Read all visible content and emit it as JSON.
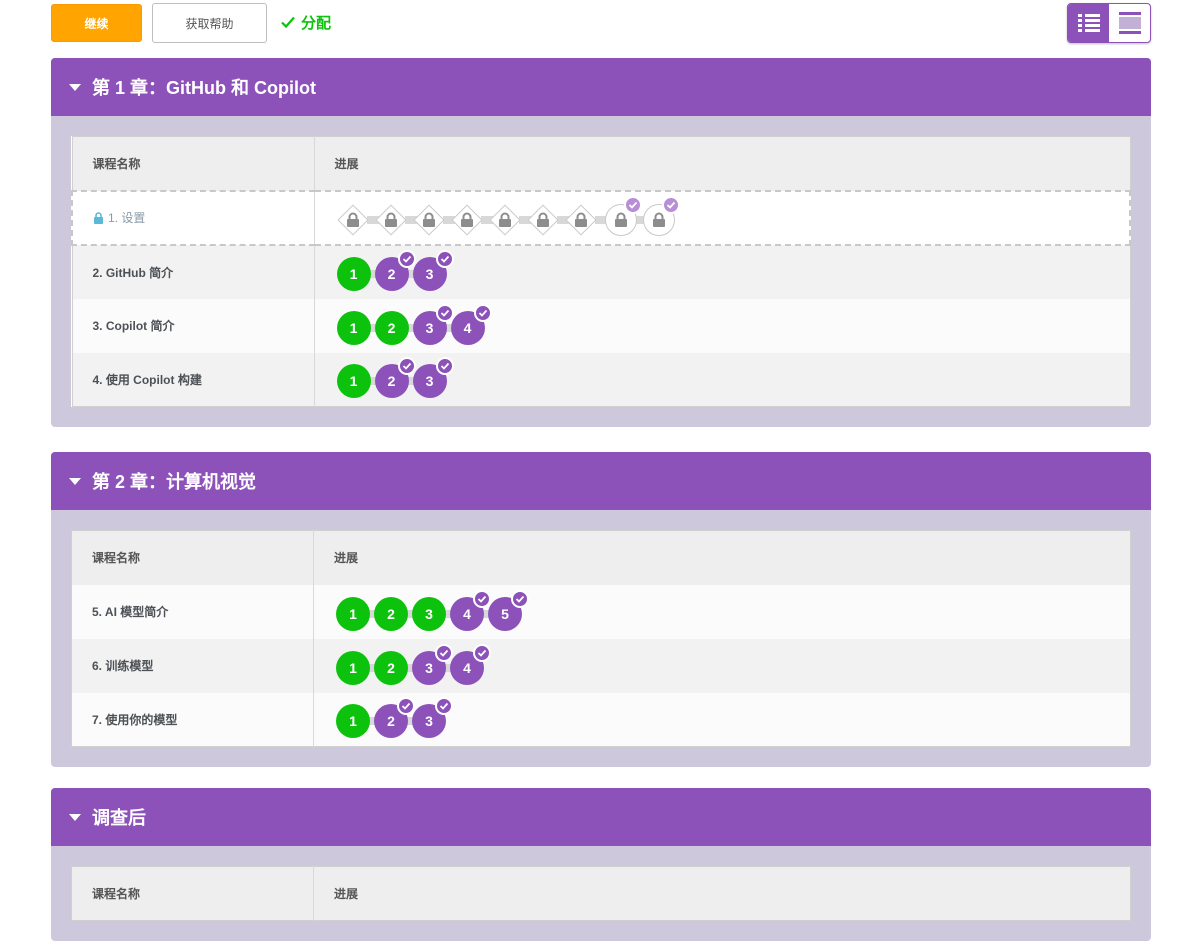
{
  "toolbar": {
    "continue_label": "继续",
    "help_label": "获取帮助",
    "assigned_label": "分配"
  },
  "colors": {
    "purple": "#8c52ba",
    "green": "#0dc20d",
    "orange": "#ffa400",
    "section_bg": "#cdc8dc"
  },
  "columns": {
    "lesson": "课程名称",
    "progress": "进展"
  },
  "sections": [
    {
      "title": "第 1 章：GitHub 和 Copilot",
      "lessons": [
        {
          "name": "1. 设置",
          "locked": true,
          "bubbles": [
            {
              "kind": "diamond"
            },
            {
              "kind": "diamond"
            },
            {
              "kind": "diamond"
            },
            {
              "kind": "diamond"
            },
            {
              "kind": "diamond"
            },
            {
              "kind": "diamond"
            },
            {
              "kind": "diamond"
            },
            {
              "kind": "circle",
              "check": true
            },
            {
              "kind": "circle",
              "check": true
            }
          ]
        },
        {
          "name": "2. GitHub 简介",
          "bubbles": [
            {
              "n": "1",
              "state": "green"
            },
            {
              "n": "2",
              "state": "purple",
              "check": true
            },
            {
              "n": "3",
              "state": "purple",
              "check": true
            }
          ]
        },
        {
          "name": "3. Copilot 简介",
          "bubbles": [
            {
              "n": "1",
              "state": "green"
            },
            {
              "n": "2",
              "state": "green"
            },
            {
              "n": "3",
              "state": "purple",
              "check": true
            },
            {
              "n": "4",
              "state": "purple",
              "check": true
            }
          ]
        },
        {
          "name": "4. 使用 Copilot 构建",
          "bubbles": [
            {
              "n": "1",
              "state": "green"
            },
            {
              "n": "2",
              "state": "purple",
              "check": true
            },
            {
              "n": "3",
              "state": "purple",
              "check": true
            }
          ]
        }
      ]
    },
    {
      "title": "第 2 章：计算机视觉",
      "lessons": [
        {
          "name": "5. AI 模型简介",
          "bubbles": [
            {
              "n": "1",
              "state": "green"
            },
            {
              "n": "2",
              "state": "green"
            },
            {
              "n": "3",
              "state": "green"
            },
            {
              "n": "4",
              "state": "purple",
              "check": true
            },
            {
              "n": "5",
              "state": "purple",
              "check": true
            }
          ]
        },
        {
          "name": "6. 训练模型",
          "bubbles": [
            {
              "n": "1",
              "state": "green"
            },
            {
              "n": "2",
              "state": "green"
            },
            {
              "n": "3",
              "state": "purple",
              "check": true
            },
            {
              "n": "4",
              "state": "purple",
              "check": true
            }
          ]
        },
        {
          "name": "7. 使用你的模型",
          "bubbles": [
            {
              "n": "1",
              "state": "green"
            },
            {
              "n": "2",
              "state": "purple",
              "check": true
            },
            {
              "n": "3",
              "state": "purple",
              "check": true
            }
          ]
        }
      ]
    },
    {
      "title": "调查后",
      "lessons": []
    }
  ]
}
